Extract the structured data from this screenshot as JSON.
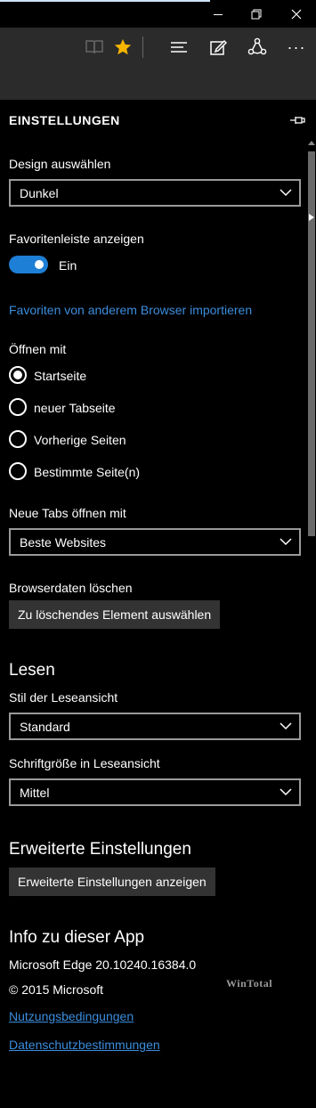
{
  "window": {
    "minimize_glyph": "—",
    "restore_glyph": "❐",
    "close_glyph": "✕"
  },
  "toolbar": {
    "reading_view_icon": "book-icon",
    "favorite_icon": "star-icon",
    "hub_icon": "hub-icon",
    "note_icon": "pen-icon",
    "share_icon": "share-icon",
    "more_glyph": "···",
    "accent_star": "#f7b500"
  },
  "settings": {
    "title": "EINSTELLUNGEN",
    "pin_icon": "pin-icon",
    "design": {
      "label": "Design auswählen",
      "value": "Dunkel"
    },
    "favorites_bar": {
      "label": "Favoritenleiste anzeigen",
      "state": "Ein",
      "on": true
    },
    "import_link": "Favoriten von anderem Browser importieren",
    "open_with": {
      "label": "Öffnen mit",
      "options": [
        "Startseite",
        "neuer Tabseite",
        "Vorherige Seiten",
        "Bestimmte Seite(n)"
      ],
      "selected": "Startseite"
    },
    "new_tabs": {
      "label": "Neue Tabs öffnen mit",
      "value": "Beste Websites"
    },
    "clear_data": {
      "label": "Browserdaten löschen",
      "button": "Zu löschendes Element auswählen"
    },
    "reading": {
      "heading": "Lesen",
      "style_label": "Stil der Leseansicht",
      "style_value": "Standard",
      "font_label": "Schriftgröße in Leseansicht",
      "font_value": "Mittel"
    },
    "advanced": {
      "heading": "Erweiterte Einstellungen",
      "button": "Erweiterte Einstellungen anzeigen"
    },
    "about": {
      "heading": "Info zu dieser App",
      "version": "Microsoft Edge 20.10240.16384.0",
      "copyright": "© 2015 Microsoft",
      "terms_link": "Nutzungsbedingungen",
      "privacy_link": "Datenschutzbestimmungen"
    }
  },
  "watermark": "WinTotal"
}
